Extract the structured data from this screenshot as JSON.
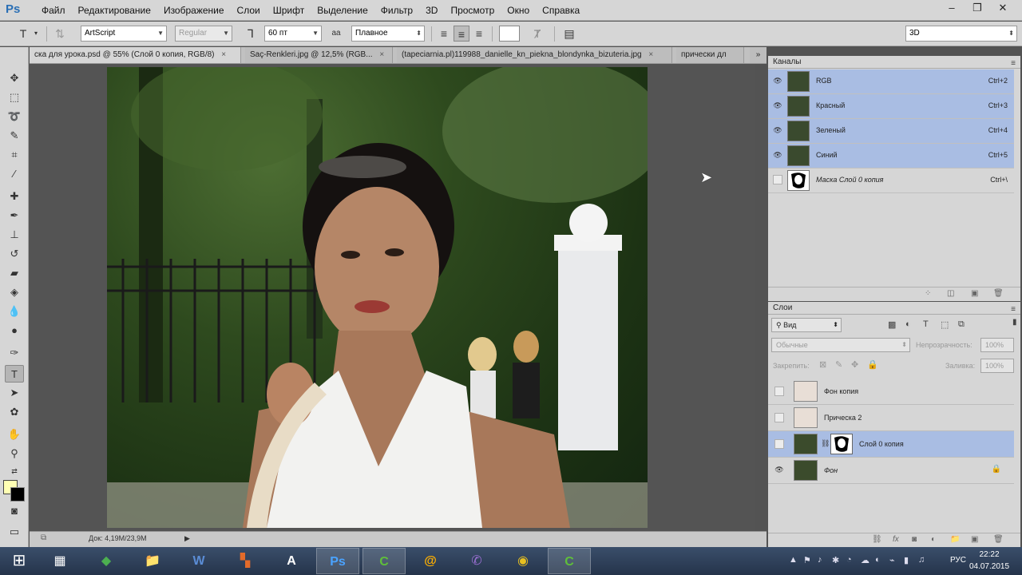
{
  "app": {
    "logo": "Ps"
  },
  "menu": [
    "Файл",
    "Редактирование",
    "Изображение",
    "Слои",
    "Шрифт",
    "Выделение",
    "Фильтр",
    "3D",
    "Просмотр",
    "Окно",
    "Справка"
  ],
  "window_controls": {
    "minimize": "–",
    "restore": "❐",
    "close": "✕"
  },
  "options": {
    "tool_glyph": "T",
    "font_family": "ArtScript",
    "font_style": "Regular",
    "font_size": "60 пт",
    "aa_icon": "aa",
    "antialias": "Плавное",
    "workspace": "3D"
  },
  "tabs": [
    {
      "label": "ска для урока.psd @ 55% (Слой 0 копия, RGB/8)",
      "close": "×"
    },
    {
      "label": "Saç-Renkleri.jpg @ 12,5% (RGB...",
      "close": "×"
    },
    {
      "label": "(tapeciarnia.pl)119988_danielle_kn_piekna_blondynka_bizuteria.jpg",
      "close": "×"
    },
    {
      "label": "прически дл",
      "close": ""
    }
  ],
  "tabs_overflow": "»",
  "status": {
    "doc_size": "Док: 4,19M/23,9M",
    "arrow": "▶"
  },
  "channels_panel": {
    "title": "Каналы",
    "menu_icon": "≡",
    "items": [
      {
        "name": "RGB",
        "shortcut": "Ctrl+2",
        "eye": "👁"
      },
      {
        "name": "Красный",
        "shortcut": "Ctrl+3",
        "eye": "👁"
      },
      {
        "name": "Зеленый",
        "shortcut": "Ctrl+4",
        "eye": "👁"
      },
      {
        "name": "Синий",
        "shortcut": "Ctrl+5",
        "eye": "👁"
      },
      {
        "name": "Маска Слой 0 копия",
        "shortcut": "Ctrl+\\",
        "eye": ""
      }
    ]
  },
  "layers_panel": {
    "title": "Слои",
    "menu_icon": "≡",
    "filter": "Вид",
    "blend_mode": "Обычные",
    "opacity_label": "Непрозрачность:",
    "opacity_value": "100%",
    "lock_label": "Закрепить:",
    "fill_label": "Заливка:",
    "fill_value": "100%",
    "layers": [
      {
        "name": "Фон копия",
        "eye": "",
        "link": "",
        "lock": ""
      },
      {
        "name": "Прическа 2",
        "eye": "",
        "link": "",
        "lock": ""
      },
      {
        "name": "Слой 0 копия",
        "eye": "",
        "link": "⛓",
        "lock": ""
      },
      {
        "name": "Фон",
        "eye": "👁",
        "link": "",
        "lock": "🔒"
      }
    ]
  },
  "taskbar": {
    "start": "⊞",
    "apps": [
      {
        "name": "explorer-computer",
        "glyph": "▦"
      },
      {
        "name": "app-red-green",
        "glyph": "◆"
      },
      {
        "name": "file-explorer",
        "glyph": "📁"
      },
      {
        "name": "word",
        "glyph": "W"
      },
      {
        "name": "office-tiles",
        "glyph": "▚"
      },
      {
        "name": "app-a",
        "glyph": "A"
      },
      {
        "name": "photoshop",
        "glyph": "Ps"
      },
      {
        "name": "camtasia",
        "glyph": "C"
      },
      {
        "name": "mail-agent",
        "glyph": "@"
      },
      {
        "name": "viber",
        "glyph": "✆"
      },
      {
        "name": "chrome",
        "glyph": "◉"
      },
      {
        "name": "camtasia-recorder",
        "glyph": "C"
      }
    ],
    "tray_icons": [
      "▲",
      "⚑",
      "♪",
      "✱",
      "◔",
      "☁",
      "◐",
      "⌁",
      "▮",
      "♫"
    ],
    "language": "РУС",
    "time": "22:22",
    "date": "04.07.2015"
  }
}
